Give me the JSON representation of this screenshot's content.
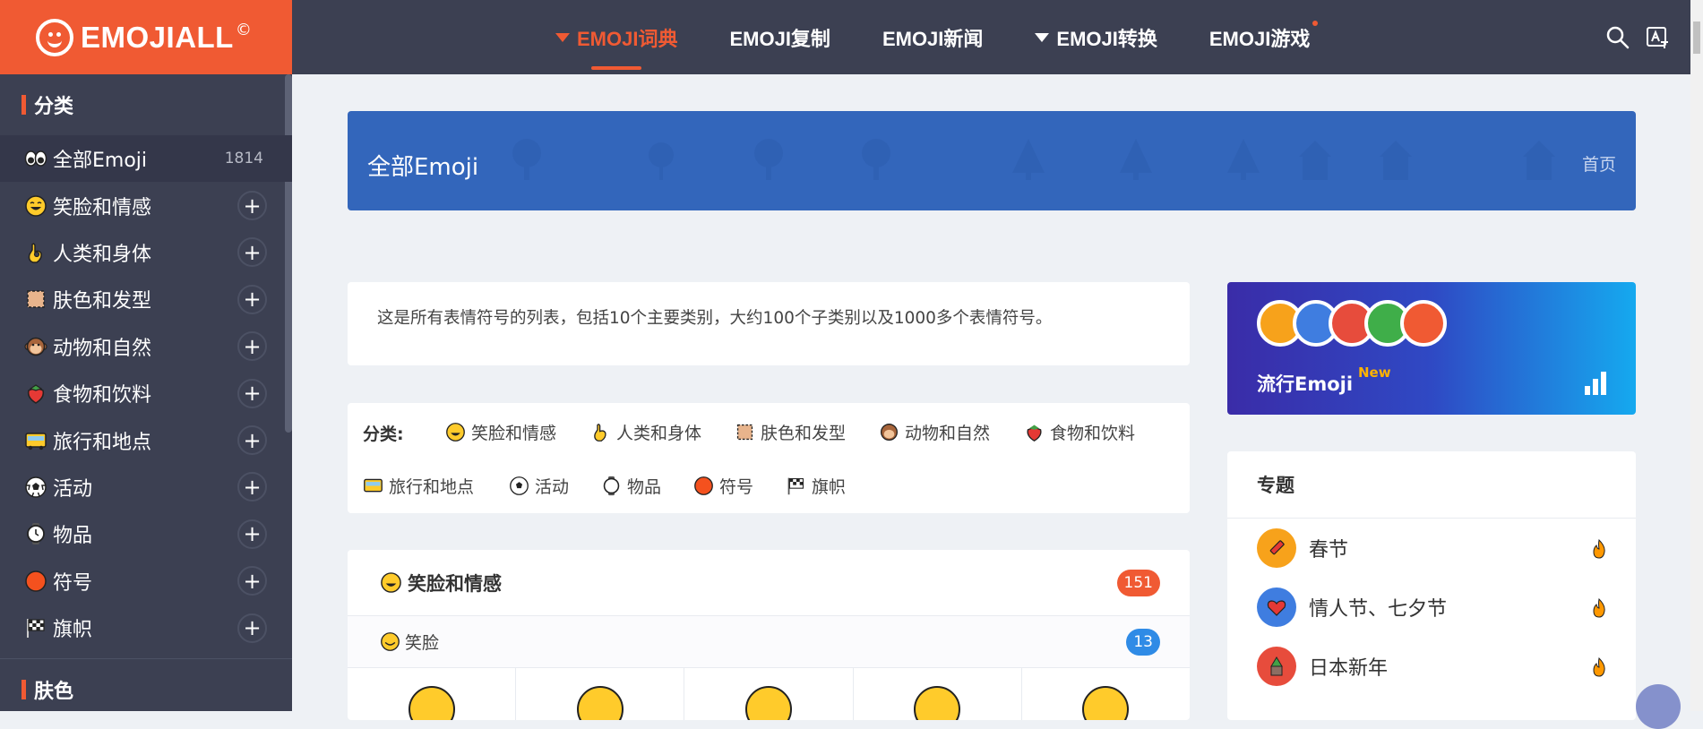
{
  "brand": {
    "logo_text": "EMOJIALL",
    "logo_mark": "©",
    "accent": "#f05a33",
    "header_bg": "#3c4052"
  },
  "nav": {
    "items": [
      {
        "label": "EMOJI词典",
        "dropdown": true,
        "active": true
      },
      {
        "label": "EMOJI复制",
        "dropdown": false
      },
      {
        "label": "EMOJI新闻",
        "dropdown": false
      },
      {
        "label": "EMOJI转换",
        "dropdown": true
      },
      {
        "label": "EMOJI游戏",
        "dropdown": false,
        "dot": true
      }
    ],
    "icons": [
      "search-icon",
      "translate-icon"
    ]
  },
  "sidebar": {
    "heading": "分类",
    "items": [
      {
        "label": "全部Emoji",
        "count": "1814",
        "icon": "eyes-icon"
      },
      {
        "label": "笑脸和情感",
        "icon": "grinning-face-icon"
      },
      {
        "label": "人类和身体",
        "icon": "ok-hand-icon"
      },
      {
        "label": "肤色和发型",
        "icon": "skin-tone-icon"
      },
      {
        "label": "动物和自然",
        "icon": "monkey-icon"
      },
      {
        "label": "食物和饮料",
        "icon": "strawberry-icon"
      },
      {
        "label": "旅行和地点",
        "icon": "bus-icon"
      },
      {
        "label": "活动",
        "icon": "soccer-ball-icon"
      },
      {
        "label": "物品",
        "icon": "watch-icon"
      },
      {
        "label": "符号",
        "icon": "red-circle-icon"
      },
      {
        "label": "旗帜",
        "icon": "checkered-flag-icon"
      }
    ],
    "heading2": "肤色"
  },
  "banner": {
    "title": "全部Emoji",
    "breadcrumb": "首页",
    "bg": "#3366bb"
  },
  "intro": "这是所有表情符号的列表，包括10个主要类别，大约100个子类别以及1000多个表情符号。",
  "categories": {
    "label": "分类:",
    "items": [
      "笑脸和情感",
      "人类和身体",
      "肤色和发型",
      "动物和自然",
      "食物和饮料",
      "旅行和地点",
      "活动",
      "物品",
      "符号",
      "旗帜"
    ]
  },
  "section": {
    "title": "笑脸和情感",
    "count": "151",
    "sub_title": "笑脸",
    "sub_count": "13"
  },
  "trending": {
    "title": "流行Emoji",
    "new_label": "New"
  },
  "topics": {
    "title": "专题",
    "items": [
      {
        "label": "春节",
        "color": "#f7a21b"
      },
      {
        "label": "情人节、七夕节",
        "color": "#3f7de0"
      },
      {
        "label": "日本新年",
        "color": "#e74c3c"
      }
    ]
  }
}
